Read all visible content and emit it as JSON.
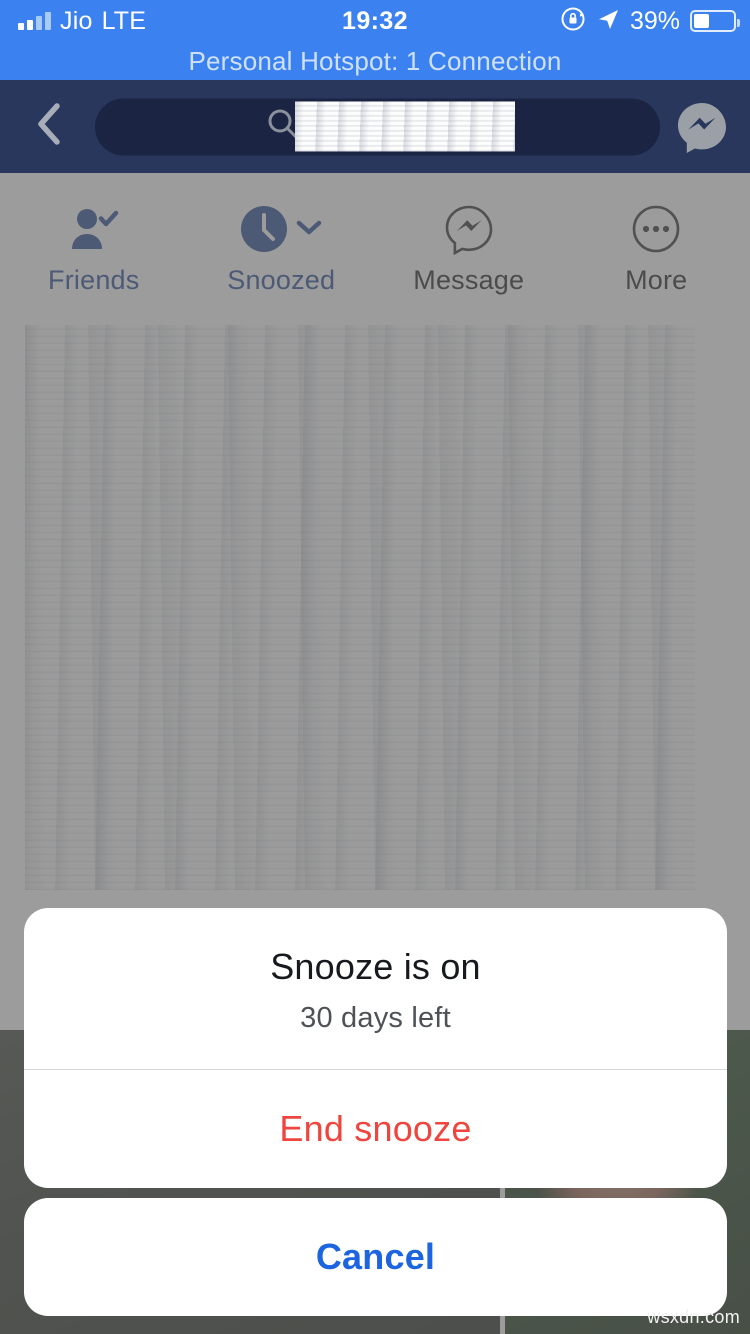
{
  "status_bar": {
    "carrier": "Jio",
    "network": "LTE",
    "time": "19:32",
    "battery_percent": "39%",
    "battery_level": 39,
    "icons": [
      "signal-bars-icon",
      "rotation-lock-icon",
      "location-arrow-icon",
      "battery-icon"
    ],
    "background_color": "#3b82f0"
  },
  "hotspot_banner": {
    "text": "Personal Hotspot: 1 Connection"
  },
  "nav_bar": {
    "back_icon": "chevron-left-icon",
    "search_placeholder": "",
    "search_value": "",
    "search_icon": "search-icon",
    "messenger_icon": "messenger-icon",
    "background_color": "#29375d"
  },
  "action_row": {
    "items": [
      {
        "label": "Friends",
        "icon": "friend-check-icon",
        "state": "active"
      },
      {
        "label": "Snoozed",
        "icon": "clock-icon",
        "state": "active",
        "chevron": "chevron-down-icon"
      },
      {
        "label": "Message",
        "icon": "messenger-outline-icon",
        "state": "plain"
      },
      {
        "label": "More",
        "icon": "ellipsis-circle-icon",
        "state": "plain"
      }
    ]
  },
  "action_sheet": {
    "title": "Snooze is on",
    "subtitle": "30 days left",
    "end_snooze_label": "End snooze",
    "end_snooze_color": "#f0453f",
    "cancel_label": "Cancel",
    "cancel_color": "#1c64e0"
  },
  "watermark": {
    "text": "wsxdn.com"
  }
}
